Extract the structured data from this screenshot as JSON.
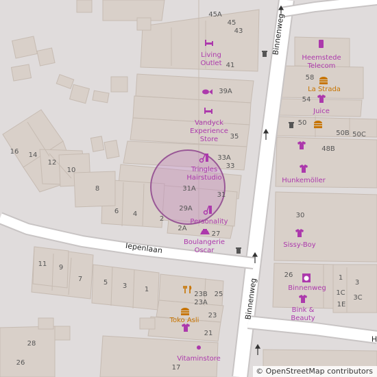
{
  "map": {
    "location_circle_color": "#c080c0",
    "streets": {
      "binnenweg_top": "Binnenweg",
      "binnenweg_bottom": "Binnenweg",
      "iepenlaan": "Iepenlaan",
      "partial_h": "H"
    },
    "house_numbers": {
      "n45a": "45A",
      "n45": "45",
      "n43": "43",
      "n41": "41",
      "n39a": "39A",
      "n35": "35",
      "n33a": "33A",
      "n33": "33",
      "n31a": "31A",
      "n31": "31",
      "n29a": "29A",
      "n27": "27",
      "n2a": "2A",
      "n2": "2",
      "n4": "4",
      "n6": "6",
      "n8": "8",
      "n10": "10",
      "n12": "12",
      "n14": "14",
      "n16": "16",
      "n11": "11",
      "n9": "9",
      "n7": "7",
      "n5": "5",
      "n3": "3",
      "n1": "1",
      "n23b": "23B",
      "n23a": "23A",
      "n25": "25",
      "n23": "23",
      "n21": "21",
      "n28": "28",
      "n26": "26",
      "n17": "17",
      "n58": "58",
      "n54": "54",
      "n50": "50",
      "n50b": "50B",
      "n50c": "50C",
      "n48b": "48B",
      "n30": "30",
      "n26r": "26",
      "n1r": "1",
      "n3r": "3",
      "n1c": "1C",
      "n3c": "3C",
      "n1e": "1E"
    },
    "pois": {
      "living_outlet": "Living\nOutlet",
      "vandyck": "Vandyck\nExperience\nStore",
      "tringles": "Tringles\nHairstudio",
      "personality": "Personality",
      "boulangerie": "Boulangerie\nOscar",
      "heemstede_telecom": "Heemstede\nTelecom",
      "la_strada": "La Strada",
      "juice": "Juice",
      "hunkemoller": "Hunkemöller",
      "sissy_boy": "Sissy-Boy",
      "binnenweg_shop": "Binnenweg",
      "bink_beauty": "Bink &\nBeauty",
      "toko_asli": "Toko Asli",
      "vitaminstore": "Vitaminstore"
    },
    "icons": {
      "furniture": "bed-icon",
      "fish": "fish-icon",
      "hairdresser": "scissors-comb-icon",
      "bakery": "bakery-icon",
      "phone": "mobile-phone-icon",
      "fastfood": "burger-icon",
      "clothes": "shirt-icon",
      "laundry": "washing-machine-icon",
      "restaurant": "fork-knife-icon",
      "waste": "waste-basket-icon",
      "oneway": "oneway-arrow-icon"
    }
  },
  "attribution": {
    "symbol": "©",
    "text": "OpenStreetMap contributors"
  }
}
